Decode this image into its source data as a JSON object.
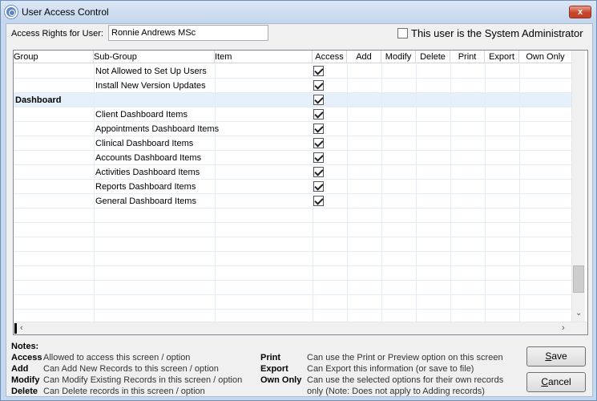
{
  "window": {
    "title": "User Access Control",
    "close_glyph": "x"
  },
  "header": {
    "rights_label": "Access Rights for User:",
    "rights_value": "Ronnie Andrews MSc",
    "admin_label": "This user is the System Administrator",
    "admin_checked": false
  },
  "grid": {
    "columns": [
      "Group",
      "Sub-Group",
      "Item",
      "Access",
      "Add",
      "Modify",
      "Delete",
      "Print",
      "Export",
      "Own Only"
    ],
    "rows": [
      {
        "group": "",
        "subgroup": "Not Allowed to Set Up Users",
        "item": "",
        "access": true
      },
      {
        "group": "",
        "subgroup": "Install New Version Updates",
        "item": "",
        "access": true
      },
      {
        "group": "Dashboard",
        "subgroup": "",
        "item": "",
        "access": true
      },
      {
        "group": "",
        "subgroup": "Client Dashboard Items",
        "item": "",
        "access": true
      },
      {
        "group": "",
        "subgroup": "Appointments Dashboard Items",
        "item": "",
        "access": true
      },
      {
        "group": "",
        "subgroup": "Clinical Dashboard Items",
        "item": "",
        "access": true
      },
      {
        "group": "",
        "subgroup": "Accounts Dashboard Items",
        "item": "",
        "access": true
      },
      {
        "group": "",
        "subgroup": "Activities Dashboard Items",
        "item": "",
        "access": true
      },
      {
        "group": "",
        "subgroup": "Reports Dashboard Items",
        "item": "",
        "access": true
      },
      {
        "group": "",
        "subgroup": "General Dashboard Items",
        "item": "",
        "access": true
      }
    ],
    "empty_rows": 8,
    "selected_row": 2
  },
  "notes": {
    "title": "Notes:",
    "items": [
      {
        "key": "Access",
        "text": "Allowed to access this screen / option"
      },
      {
        "key": "Add",
        "text": "Can Add New Records to this screen / option"
      },
      {
        "key": "Modify",
        "text": "Can Modify Existing Records in this screen / option"
      },
      {
        "key": "Delete",
        "text": "Can Delete records in this screen / option"
      },
      {
        "key": "Print",
        "text": "Can use the Print or Preview option on this screen"
      },
      {
        "key": "Export",
        "text": "Can Export this information (or save to file)"
      },
      {
        "key": "Own Only",
        "text": "Can use the selected options for their own records"
      },
      {
        "key": "",
        "text": "only (Note: Does not apply to Adding records)"
      }
    ]
  },
  "buttons": {
    "save_accel": "S",
    "save_rest": "ave",
    "cancel_accel": "C",
    "cancel_rest": "ancel"
  }
}
